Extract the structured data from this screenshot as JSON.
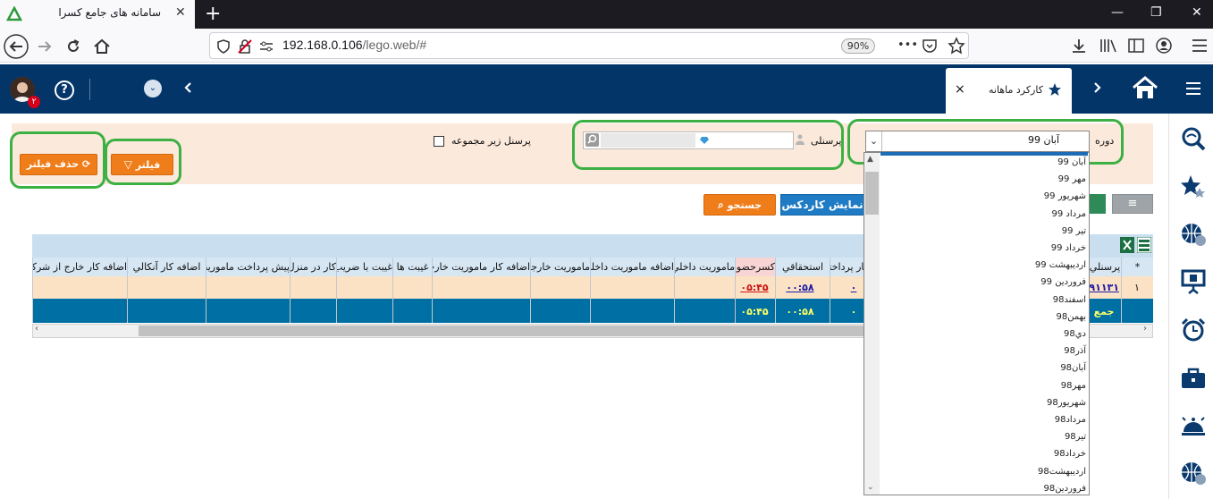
{
  "browser": {
    "tab_title": "سامانه های جامع کسرا",
    "tab_close": "✕",
    "new_tab": "+",
    "url_host": "192.168.0.106",
    "url_path": "/lego.web/#",
    "zoom": "90%",
    "more": "•••"
  },
  "app": {
    "active_tab": "کارکرد ماهانه",
    "tab_close": "×",
    "notification_count": "۲",
    "help": "?"
  },
  "filters": {
    "doreh_label": "دوره",
    "doreh_value": "آبان 99",
    "personnel_label": "پرسنلی",
    "sub_personnel_label": "پرسنل زیر مجموعه",
    "filter_button": "فیلتر",
    "remove_filter_button": "حذف فیلتر"
  },
  "toolbar": {
    "search_button": "جستجو",
    "cardex_button": "نمایش کاردکس"
  },
  "grid": {
    "columns": [
      "*",
      "پرسنلي",
      "کار پرداختي",
      "استحقاقي",
      "کسرحضور",
      "ماموريت داخلي",
      "اضافه ماموريت داخلي",
      "ماموريت خارجي",
      "اضافه کار ماموريت خارجي",
      "غيبت ها",
      "غيبت با ضريب",
      "کار در منزل",
      "پيش پرداخت ماموريت",
      "اضافه کار آنکالي",
      "اضافه کار خارج از شرکت"
    ],
    "rows": [
      {
        "index": "۱",
        "personnel": "۸۹۱۱۳۱",
        "kar_pardakhti": "۰",
        "estehghaghi": "۰۰:۵۸",
        "kasr_hozoor": "۰۵:۴۵"
      }
    ],
    "total": {
      "label": "جمع",
      "kar_pardakhti": "۰",
      "estehghaghi": "۰۰:۵۸",
      "kasr_hozoor": "۰۵:۴۵"
    }
  },
  "dropdown": {
    "items": [
      "آبان 99",
      "مهر 99",
      "شهريور 99",
      "مرداد 99",
      "تير 99",
      "خرداد 99",
      "ارديبهشت 99",
      "فروردين 99",
      "اسفند98",
      "بهمن98",
      "دي98",
      "آذر98",
      "آبان98",
      "مهر98",
      "شهريور98",
      "مرداد98",
      "تير98",
      "خرداد98",
      "ارديبهشت98",
      "فروردين98"
    ]
  },
  "colors": {
    "header_bg": "#033569",
    "filter_bg": "#fbe9dc",
    "orange": "#ef7d1a",
    "blue_button": "#1e7bc4",
    "highlight_green": "#3cb043",
    "total_row": "#006fa3"
  }
}
